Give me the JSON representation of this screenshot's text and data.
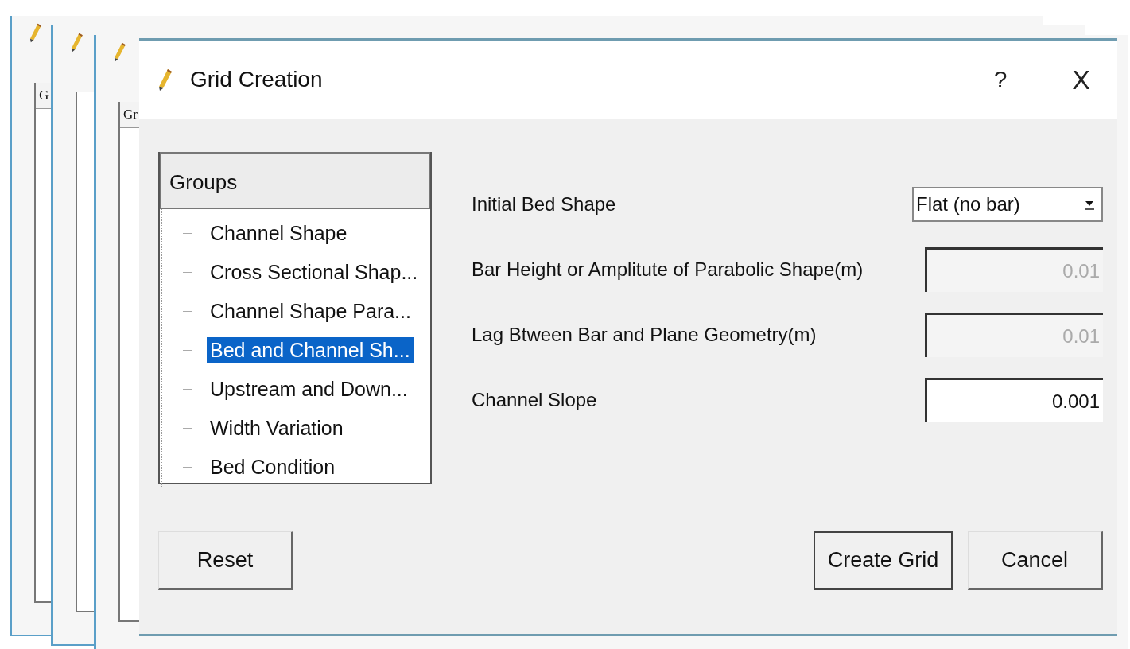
{
  "background_windows": [
    {
      "kind": "window",
      "header": "G"
    },
    {
      "kind": "window"
    },
    {
      "kind": "window",
      "header": "Gr"
    }
  ],
  "dialog": {
    "title": "Grid Creation",
    "help": "?",
    "close": "X"
  },
  "tree": {
    "header": "Groups",
    "items": [
      {
        "label": "Channel Shape",
        "selected": false
      },
      {
        "label": "Cross Sectional Shap...",
        "selected": false
      },
      {
        "label": "Channel Shape Para...",
        "selected": false
      },
      {
        "label": "Bed and Channel Sh...",
        "selected": true
      },
      {
        "label": "Upstream and Down...",
        "selected": false
      },
      {
        "label": "Width Variation",
        "selected": false
      },
      {
        "label": "Bed Condition",
        "selected": false
      }
    ]
  },
  "fields": [
    {
      "kind": "dropdown",
      "label": "Initial Bed Shape",
      "value": "Flat (no bar)",
      "disabled": false
    },
    {
      "kind": "text",
      "label": "Bar Height or Amplitute of Parabolic Shape(m)",
      "value": "0.01",
      "disabled": true
    },
    {
      "kind": "text",
      "label": "Lag Btween Bar and Plane Geometry(m)",
      "value": "0.01",
      "disabled": true
    },
    {
      "kind": "text",
      "label": "Channel Slope",
      "value": "0.001",
      "disabled": false
    }
  ],
  "buttons": {
    "left": [
      "Reset"
    ],
    "right": [
      "Create Grid",
      "Cancel"
    ]
  }
}
